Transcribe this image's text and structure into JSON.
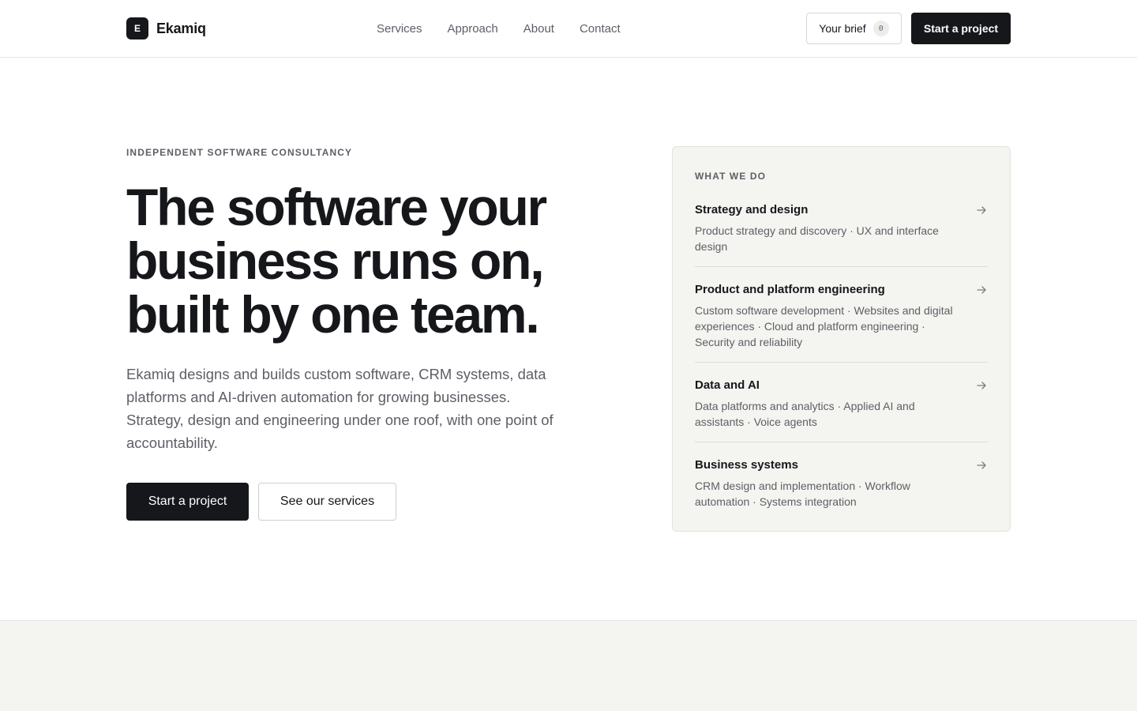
{
  "brand": {
    "logo_letter": "E",
    "name": "Ekamiq"
  },
  "nav": {
    "items": [
      {
        "label": "Services"
      },
      {
        "label": "Approach"
      },
      {
        "label": "About"
      },
      {
        "label": "Contact"
      }
    ],
    "brief_label": "Your brief",
    "brief_count": "0",
    "cta_label": "Start a project"
  },
  "hero": {
    "eyebrow": "INDEPENDENT SOFTWARE CONSULTANCY",
    "title_lines": [
      "The software your",
      "business runs on,",
      "built by one team."
    ],
    "subtitle": "Ekamiq designs and builds custom software, CRM systems, data platforms and AI-driven automation for growing businesses. Strategy, design and engineering under one roof, with one point of accountability.",
    "primary_cta": "Start a project",
    "secondary_cta": "See our services"
  },
  "services_card": {
    "label": "WHAT WE DO",
    "items": [
      {
        "title": "Strategy and design",
        "description": "Product strategy and discovery · UX and interface design"
      },
      {
        "title": "Product and platform engineering",
        "description": "Custom software development · Websites and digital experiences · Cloud and platform engineering · Security and reliability"
      },
      {
        "title": "Data and AI",
        "description": "Data platforms and analytics · Applied AI and assistants · Voice agents"
      },
      {
        "title": "Business systems",
        "description": "CRM design and implementation · Workflow automation · Systems integration"
      }
    ]
  },
  "colors": {
    "ink": "#16171b",
    "muted": "#5d5f66",
    "card_bg": "#f4f4f0",
    "border": "#e3e3de"
  }
}
